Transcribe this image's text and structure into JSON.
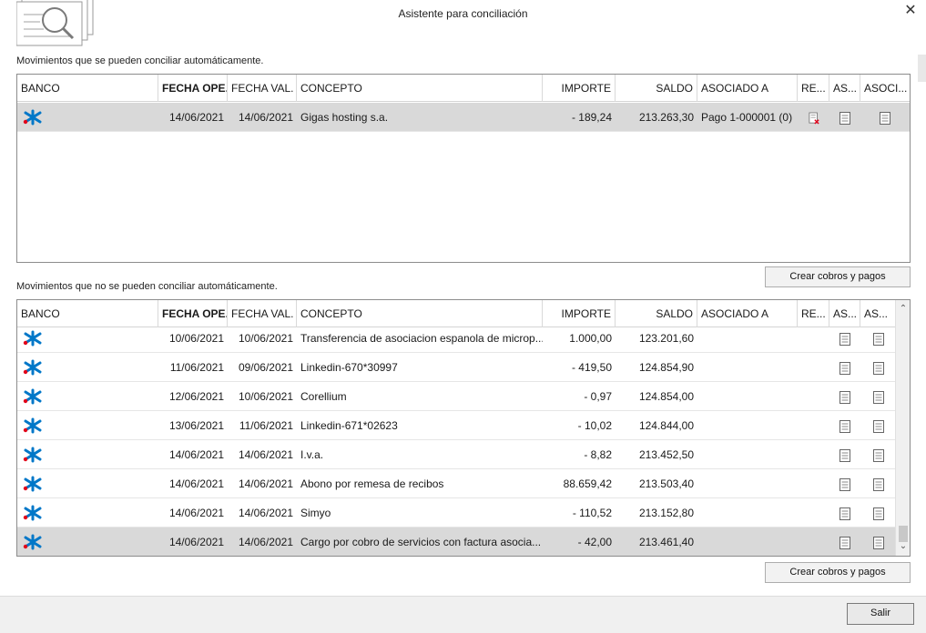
{
  "window": {
    "title": "Asistente para conciliación",
    "close_glyph": "✕"
  },
  "section1": {
    "label": "Movimientos que se pueden conciliar automáticamente.",
    "headers": {
      "banco": "BANCO",
      "fecha_ope": "FECHA OPE.",
      "fecha_val": "FECHA VAL.",
      "concepto": "CONCEPTO",
      "importe": "IMPORTE",
      "saldo": "SALDO",
      "asociado_a": "ASOCIADO A",
      "re": "RE...",
      "as": "AS...",
      "asoci": "ASOCI..."
    },
    "rows": [
      {
        "bank_icon": "caixabank-star-icon",
        "fecha_ope": "14/06/2021",
        "fecha_val": "14/06/2021",
        "concepto": "Gigas hosting s.a.",
        "importe": "- 189,24",
        "saldo": "213.263,30",
        "asociado_a": "Pago 1-000001 (0)"
      }
    ],
    "button": "Crear cobros y pagos"
  },
  "section2": {
    "label": "Movimientos que no se pueden conciliar automáticamente.",
    "headers": {
      "banco": "BANCO",
      "fecha_ope": "FECHA OPE.",
      "fecha_val": "FECHA VAL.",
      "concepto": "CONCEPTO",
      "importe": "IMPORTE",
      "saldo": "SALDO",
      "asociado_a": "ASOCIADO A",
      "re": "RE...",
      "as1": "AS...",
      "as2": "AS..."
    },
    "rows": [
      {
        "fecha_ope": "10/06/2021",
        "fecha_val": "10/06/2021",
        "concepto": "Transferencia de asociacion espanola de microp...",
        "importe": "1.000,00",
        "saldo": "123.201,60"
      },
      {
        "fecha_ope": "11/06/2021",
        "fecha_val": "09/06/2021",
        "concepto": "Linkedin-670*30997",
        "importe": "- 419,50",
        "saldo": "124.854,90"
      },
      {
        "fecha_ope": "12/06/2021",
        "fecha_val": "10/06/2021",
        "concepto": "Corellium",
        "importe": "- 0,97",
        "saldo": "124.854,00"
      },
      {
        "fecha_ope": "13/06/2021",
        "fecha_val": "11/06/2021",
        "concepto": "Linkedin-671*02623",
        "importe": "- 10,02",
        "saldo": "124.844,00"
      },
      {
        "fecha_ope": "14/06/2021",
        "fecha_val": "14/06/2021",
        "concepto": "I.v.a.",
        "importe": "- 8,82",
        "saldo": "213.452,50"
      },
      {
        "fecha_ope": "14/06/2021",
        "fecha_val": "14/06/2021",
        "concepto": "Abono por remesa de recibos",
        "importe": "88.659,42",
        "saldo": "213.503,40"
      },
      {
        "fecha_ope": "14/06/2021",
        "fecha_val": "14/06/2021",
        "concepto": "Simyo",
        "importe": "- 110,52",
        "saldo": "213.152,80"
      },
      {
        "fecha_ope": "14/06/2021",
        "fecha_val": "14/06/2021",
        "concepto": "Cargo por cobro de servicios con factura asocia...",
        "importe": "- 42,00",
        "saldo": "213.461,40"
      }
    ],
    "button": "Crear cobros y pagos"
  },
  "footer": {
    "salir": "Salir"
  },
  "colors": {
    "caixa_blue": "#0077c8",
    "caixa_red": "#e2001a",
    "selected_row": "#d9d9d9"
  }
}
